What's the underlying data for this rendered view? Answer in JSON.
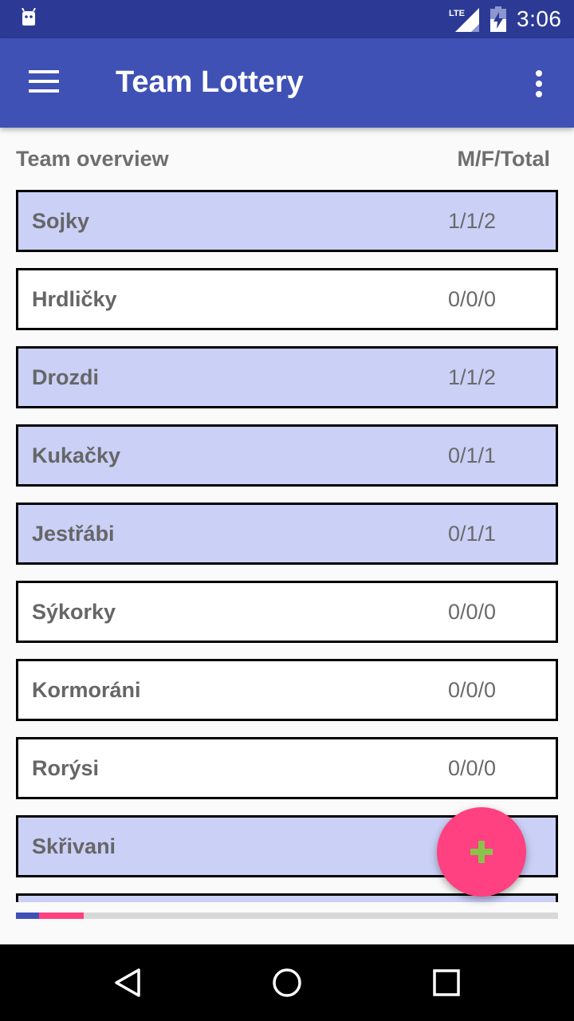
{
  "status_bar": {
    "network": "LTE",
    "time": "3:06"
  },
  "app_bar": {
    "title": "Team Lottery",
    "menu_icon": "hamburger-menu-icon",
    "overflow_icon": "more-vert-icon"
  },
  "header": {
    "left": "Team overview",
    "right": "M/F/Total"
  },
  "teams": [
    {
      "name": "Sojky",
      "count": "1/1/2",
      "highlighted": true
    },
    {
      "name": "Hrdličky",
      "count": "0/0/0",
      "highlighted": false
    },
    {
      "name": "Drozdi",
      "count": "1/1/2",
      "highlighted": true
    },
    {
      "name": "Kukačky",
      "count": "0/1/1",
      "highlighted": true
    },
    {
      "name": "Jestřábi",
      "count": "0/1/1",
      "highlighted": true
    },
    {
      "name": "Sýkorky",
      "count": "0/0/0",
      "highlighted": false
    },
    {
      "name": "Kormoráni",
      "count": "0/0/0",
      "highlighted": false
    },
    {
      "name": "Rorýsi",
      "count": "0/0/0",
      "highlighted": false
    },
    {
      "name": "Skřivani",
      "count": "",
      "highlighted": true
    }
  ],
  "fab": {
    "icon": "plus-icon"
  },
  "colors": {
    "status_bar": "#2c3a96",
    "app_bar": "#3f51b5",
    "row_highlight": "#cbd0f7",
    "accent": "#ff4081",
    "fab_plus": "#8bc34a"
  },
  "nav": {
    "back_icon": "back-triangle-icon",
    "home_icon": "home-circle-icon",
    "recents_icon": "recents-square-icon"
  }
}
